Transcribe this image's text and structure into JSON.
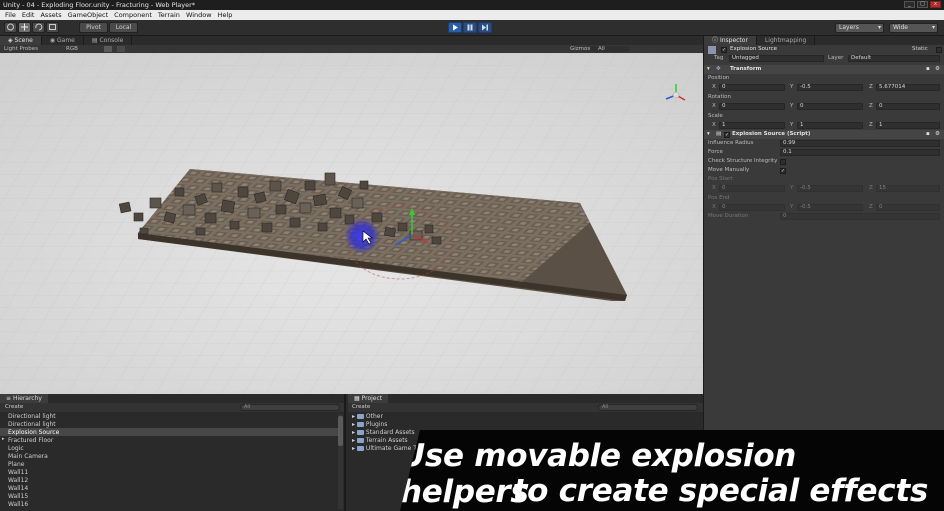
{
  "window": {
    "title": "Unity - 04 - Exploding Floor.unity - Fracturing - Web Player*"
  },
  "menu": [
    "File",
    "Edit",
    "Assets",
    "GameObject",
    "Component",
    "Terrain",
    "Window",
    "Help"
  ],
  "toolbar": {
    "pivot": "Pivot",
    "local": "Local",
    "layers": "Layers",
    "layout": "Wide"
  },
  "scene": {
    "tabs": [
      "Scene",
      "Game",
      "Console"
    ],
    "render_mode": "Light Probes",
    "color_mode": "RGB",
    "gizmos": "Gizmos",
    "search": "All"
  },
  "inspector": {
    "tabs": [
      "Inspector",
      "Lightmapping"
    ],
    "object_name": "Explosion Source",
    "static_label": "Static",
    "tag_label": "Tag",
    "tag_value": "Untagged",
    "layer_label": "Layer",
    "layer_value": "Default",
    "transform": {
      "header": "Transform",
      "position_label": "Position",
      "position": {
        "x": "0",
        "y": "-0.5",
        "z": "5.677014"
      },
      "rotation_label": "Rotation",
      "rotation": {
        "x": "0",
        "y": "0",
        "z": "0"
      },
      "scale_label": "Scale",
      "scale": {
        "x": "1",
        "y": "1",
        "z": "1"
      }
    },
    "script": {
      "header": "Explosion Source (Script)",
      "influence_radius_label": "Influence Radius",
      "influence_radius": "0.99",
      "force_label": "Force",
      "force": "0.1",
      "check_integrity_label": "Check Structure Integrity",
      "move_manually_label": "Move Manually",
      "pos_start_label": "Pos Start",
      "pos_start": {
        "x": "0",
        "y": "-0.5",
        "z": "15"
      },
      "pos_end_label": "Pos End",
      "pos_end": {
        "x": "0",
        "y": "-0.5",
        "z": "0"
      },
      "move_duration_label": "Move Duration",
      "move_duration": "0"
    }
  },
  "hierarchy": {
    "tab": "Hierarchy",
    "create": "Create",
    "search": "All",
    "items": [
      "Directional light",
      "Directional light",
      "Explosion Source",
      "Fractured Floor",
      "Logic",
      "Main Camera",
      "Plane",
      "Wall11",
      "Wall12",
      "Wall14",
      "Wall15",
      "Wall16"
    ]
  },
  "project": {
    "tab": "Project",
    "create": "Create",
    "search": "All",
    "folders": [
      "Other",
      "Plugins",
      "Standard Assets",
      "Terrain Assets",
      "Ultimate Game Tools"
    ]
  },
  "caption": {
    "line1": "Use movable explosion helpers",
    "line2": "to create special effects"
  },
  "colors": {
    "play_blue": "#2a5fa8",
    "floor_brown": "#7a6d5f",
    "snow_bg": "#d8d8d8"
  }
}
